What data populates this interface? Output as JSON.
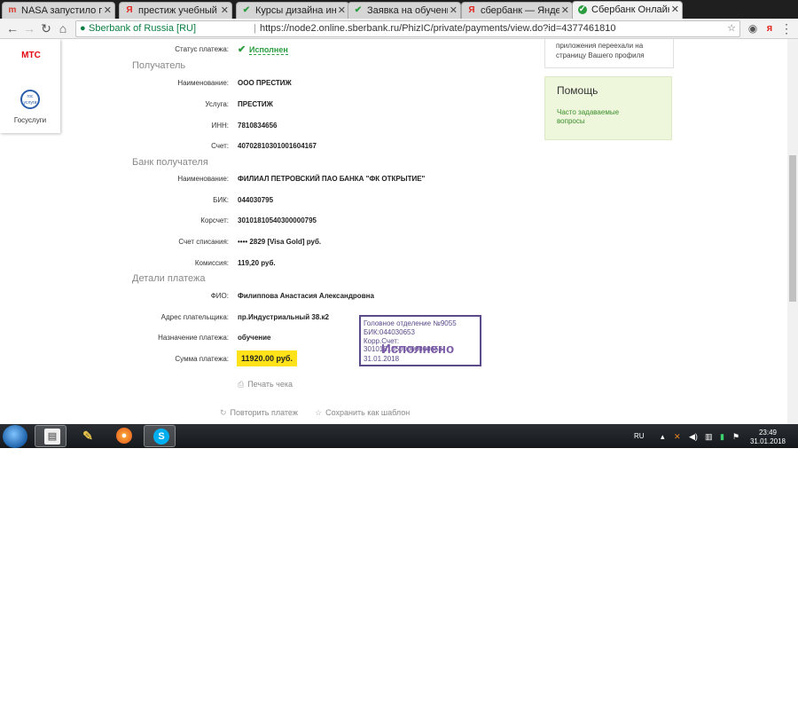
{
  "tabs": [
    {
      "favicon": "nasa-favicon",
      "title": "NASA запустило прямую"
    },
    {
      "favicon": "yandex-favicon",
      "title": "престиж учебный цент"
    },
    {
      "favicon": "check-favicon",
      "title": "Курсы дизайна интерь"
    },
    {
      "favicon": "doc-favicon",
      "title": "Заявка на обучение от"
    },
    {
      "favicon": "yandex-favicon",
      "title": "сбербанк — Яндекс: на"
    },
    {
      "favicon": "sberbank-favicon",
      "title": "Сбербанк Онлайн"
    }
  ],
  "address": {
    "site_name": "Sberbank of Russia [RU]",
    "url": "https://node2.online.sberbank.ru/PhizIC/private/payments/view.do?id=4377461810"
  },
  "sidebar": {
    "mts": "МТС",
    "gos_badge": "гос услуги",
    "gos": "Госуслуги"
  },
  "payment": {
    "status_label": "Статус платежа:",
    "status_value": "Исполнен",
    "recipient_title": "Получатель",
    "name_label": "Наименование:",
    "name_value": "ООО ПРЕСТИЖ",
    "service_label": "Услуга:",
    "service_value": "ПРЕСТИЖ",
    "inn_label": "ИНН:",
    "inn_value": "7810834656",
    "account_label": "Счет:",
    "account_value": "40702810301001604167",
    "bank_title": "Банк получателя",
    "bank_name_label": "Наименование:",
    "bank_name_value": "ФИЛИАЛ ПЕТРОВСКИЙ ПАО БАНКА \"ФК ОТКРЫТИЕ\"",
    "bik_label": "БИК:",
    "bik_value": "044030795",
    "korr_label": "Корсчет:",
    "korr_value": "30101810540300000795",
    "debit_label": "Счет списания:",
    "debit_value": "•••• 2829  [Visa Gold]  руб.",
    "fee_label": "Комиссия:",
    "fee_value": "119,20 руб.",
    "details_title": "Детали платежа",
    "fio_label": "ФИО:",
    "fio_value": "Филиппова Анастасия Александровна",
    "address_label": "Адрес плательщика:",
    "address_value": "пр.Индустриальный 38.к2",
    "purpose_label": "Назначение платежа:",
    "purpose_value": "обучение",
    "sum_label": "Сумма платежа:",
    "sum_value": "11920.00 руб."
  },
  "stamp": {
    "line1": "Головное отделение №9055",
    "line2": "БИК:044030653",
    "line3": "Корр.Счет: 30101810500000000653",
    "big": "Исполнено",
    "date": "31.01.2018"
  },
  "actions": {
    "print": "Печать чека",
    "repeat": "Повторить платеж",
    "template": "Сохранить как шаблон"
  },
  "right": {
    "info_text": "мобильные банковские приложения переехали на страницу Вашего профиля",
    "help_title": "Помощь",
    "faq": "Часто задаваемые вопросы"
  },
  "taskbar": {
    "lang": "RU",
    "time": "23:49",
    "date": "31.01.2018"
  }
}
